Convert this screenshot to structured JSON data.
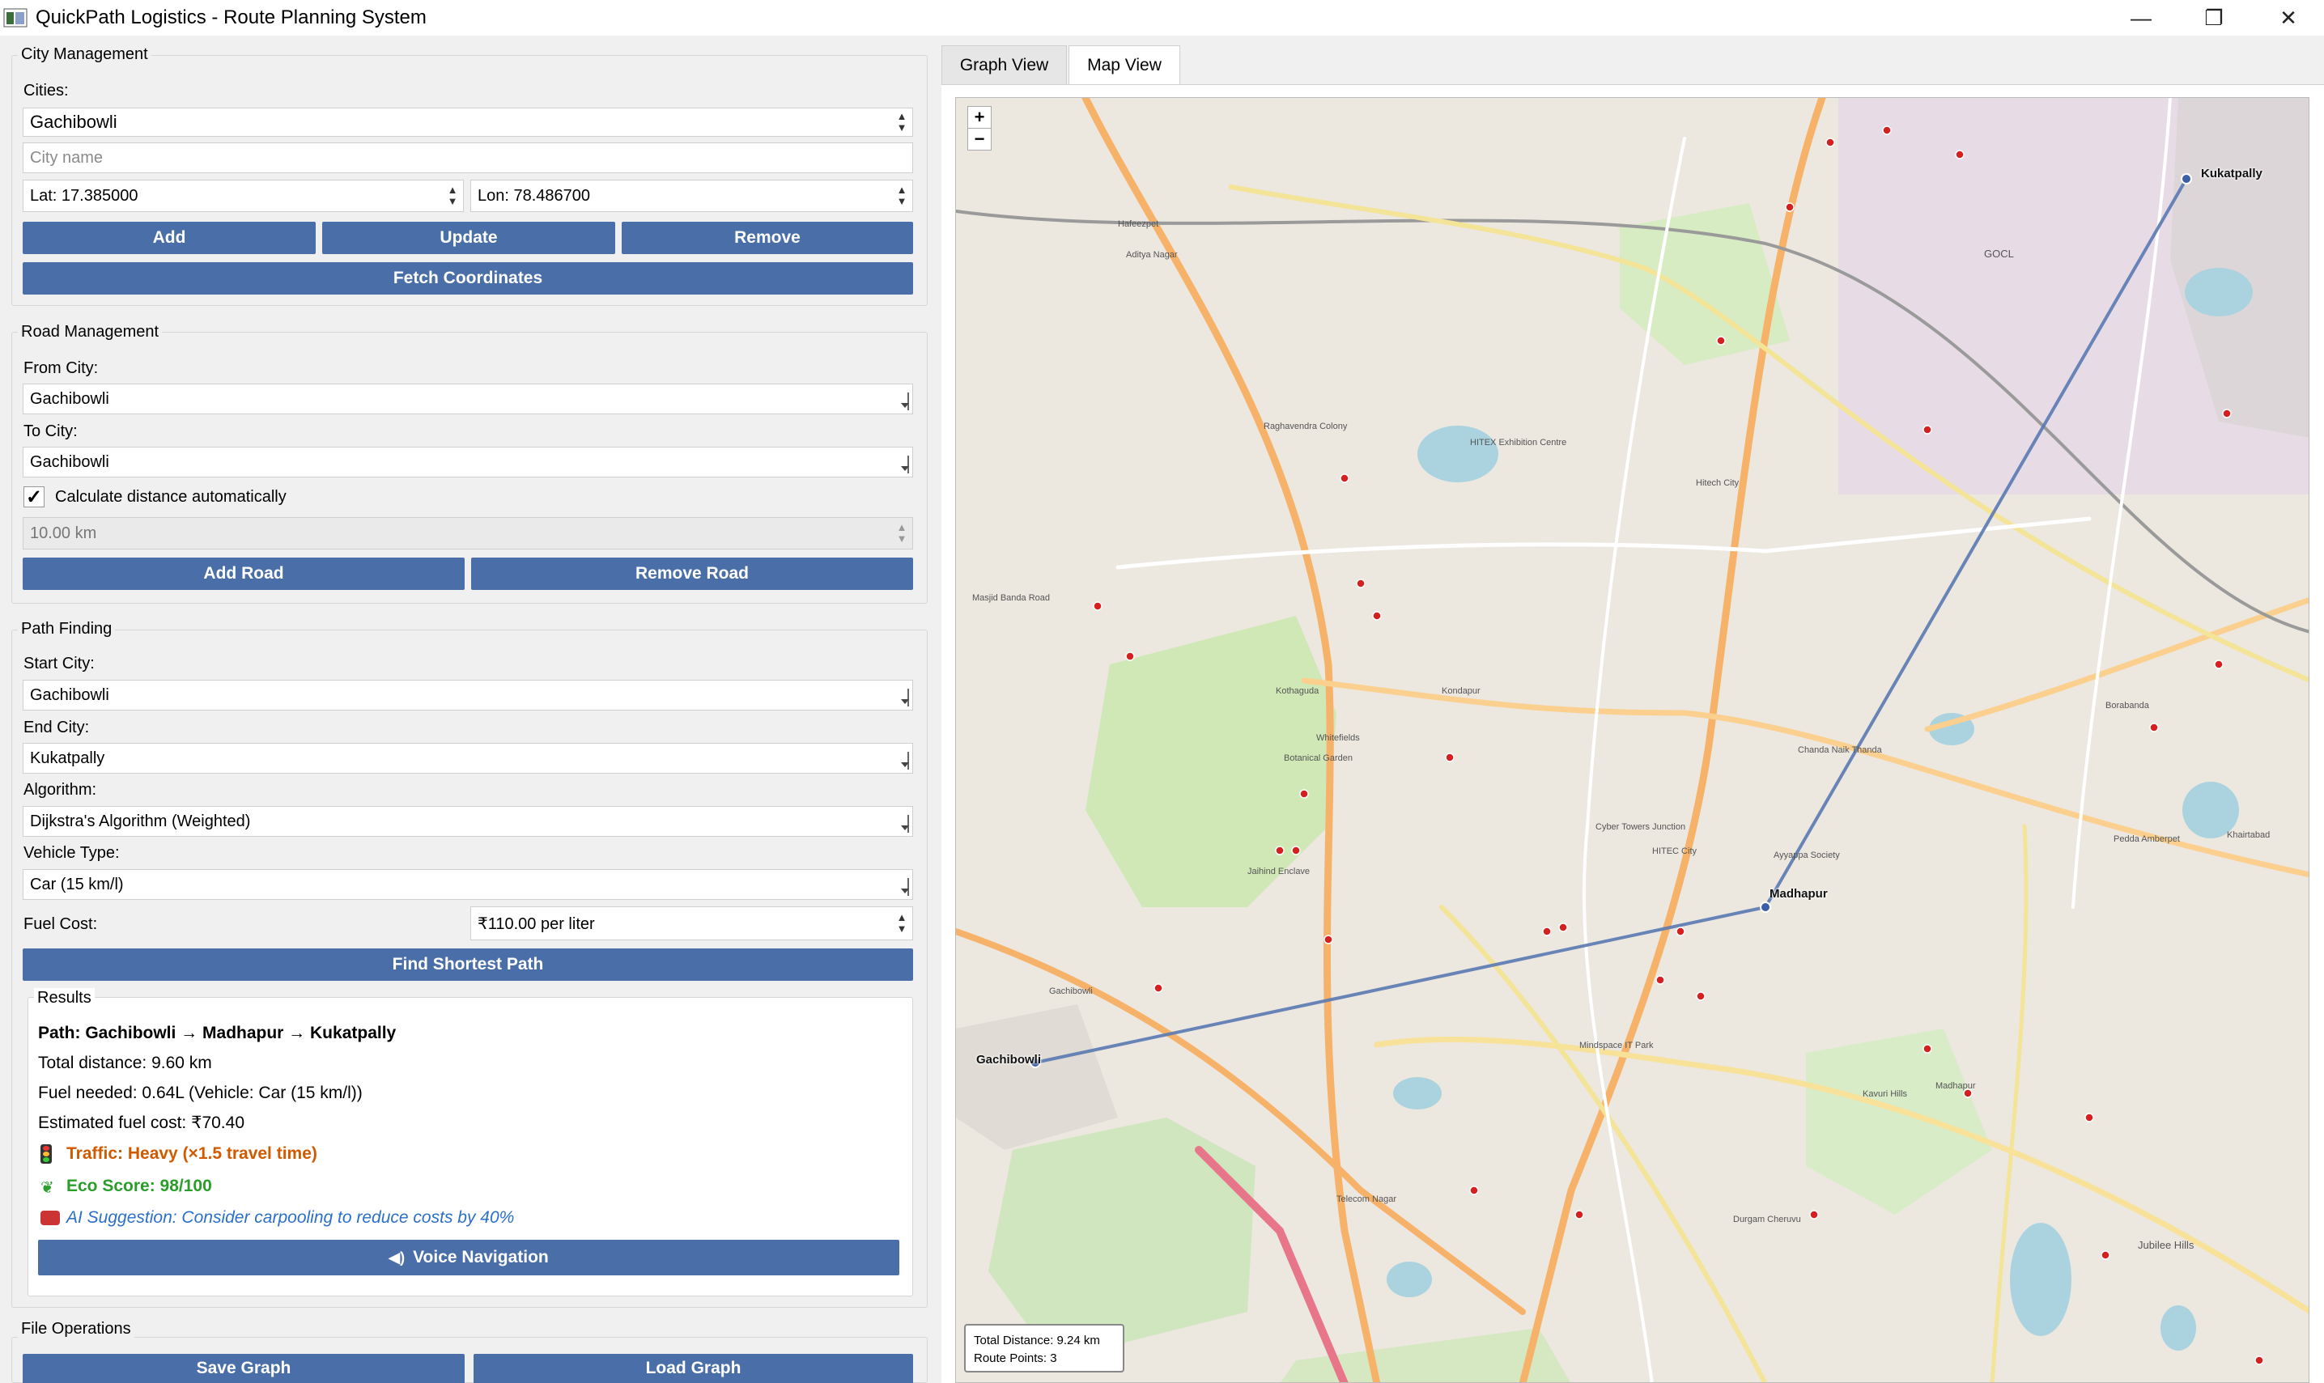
{
  "window": {
    "title": "QuickPath Logistics - Route Planning System",
    "minimize": "—",
    "maximize": "❐",
    "close": "✕"
  },
  "city_mgmt": {
    "title": "City Management",
    "cities_label": "Cities:",
    "city_selected": "Gachibowli",
    "city_name_placeholder": "City name",
    "lat": "Lat: 17.385000",
    "lon": "Lon: 78.486700",
    "add": "Add",
    "update": "Update",
    "remove": "Remove",
    "fetch": "Fetch Coordinates"
  },
  "road_mgmt": {
    "title": "Road Management",
    "from_label": "From City:",
    "from_value": "Gachibowli",
    "to_label": "To City:",
    "to_value": "Gachibowli",
    "auto_label": "Calculate distance automatically",
    "distance": "10.00 km",
    "add_road": "Add Road",
    "remove_road": "Remove Road"
  },
  "path_finding": {
    "title": "Path Finding",
    "start_label": "Start City:",
    "start_value": "Gachibowli",
    "end_label": "End City:",
    "end_value": "Kukatpally",
    "algo_label": "Algorithm:",
    "algo_value": "Dijkstra's Algorithm (Weighted)",
    "vehicle_label": "Vehicle Type:",
    "vehicle_value": "Car (15 km/l)",
    "fuel_label": "Fuel Cost:",
    "fuel_value": "₹110.00 per liter",
    "find": "Find Shortest Path"
  },
  "results": {
    "title": "Results",
    "path": "Path: Gachibowli → Madhapur → Kukatpally",
    "distance": "Total distance: 9.60 km",
    "fuel": "Fuel needed: 0.64L (Vehicle: Car (15 km/l))",
    "cost": "Estimated fuel cost: ₹70.40",
    "traffic": "Traffic: Heavy (×1.5 travel time)",
    "eco": "Eco Score: 98/100",
    "ai": "AI Suggestion: Consider carpooling to reduce costs by 40%",
    "voice": "Voice Navigation",
    "colors": {
      "traffic": "#d05a00",
      "eco": "#2a9d2a",
      "ai": "#2a6fc9"
    }
  },
  "file_ops": {
    "title": "File Operations",
    "save": "Save Graph",
    "load": "Load Graph"
  },
  "tabs": {
    "graph": "Graph View",
    "map": "Map View"
  },
  "map": {
    "zoom_in": "+",
    "zoom_out": "−",
    "cities": {
      "start": "Gachibowli",
      "mid": "Madhapur",
      "end": "Kukatpally"
    },
    "info_distance": "Total Distance: 9.24 km",
    "info_points": "Route Points: 3",
    "labels": [
      "Hafeezpet",
      "Aditya Nagar",
      "Kondapur",
      "Kothaguda",
      "HITEC City",
      "Madhapur",
      "Gachibowli",
      "Borabanda",
      "Khairtabad",
      "GOCL",
      "Cyber Towers Junction",
      "Durgam Cheruvu",
      "Jubilee Hills",
      "Hitech City",
      "Chanda Naik Thanda",
      "Jaihind Enclave",
      "Whitefields",
      "Botanical Garden",
      "Masjid Banda Road",
      "Telecom Nagar",
      "Ayyappa Society",
      "Mindspace IT Park",
      "Kavuri Hills",
      "Raghavendra Colony",
      "HITEX Exhibition Centre",
      "Pedda Amberpet"
    ],
    "route_color": "#5a79b3"
  }
}
